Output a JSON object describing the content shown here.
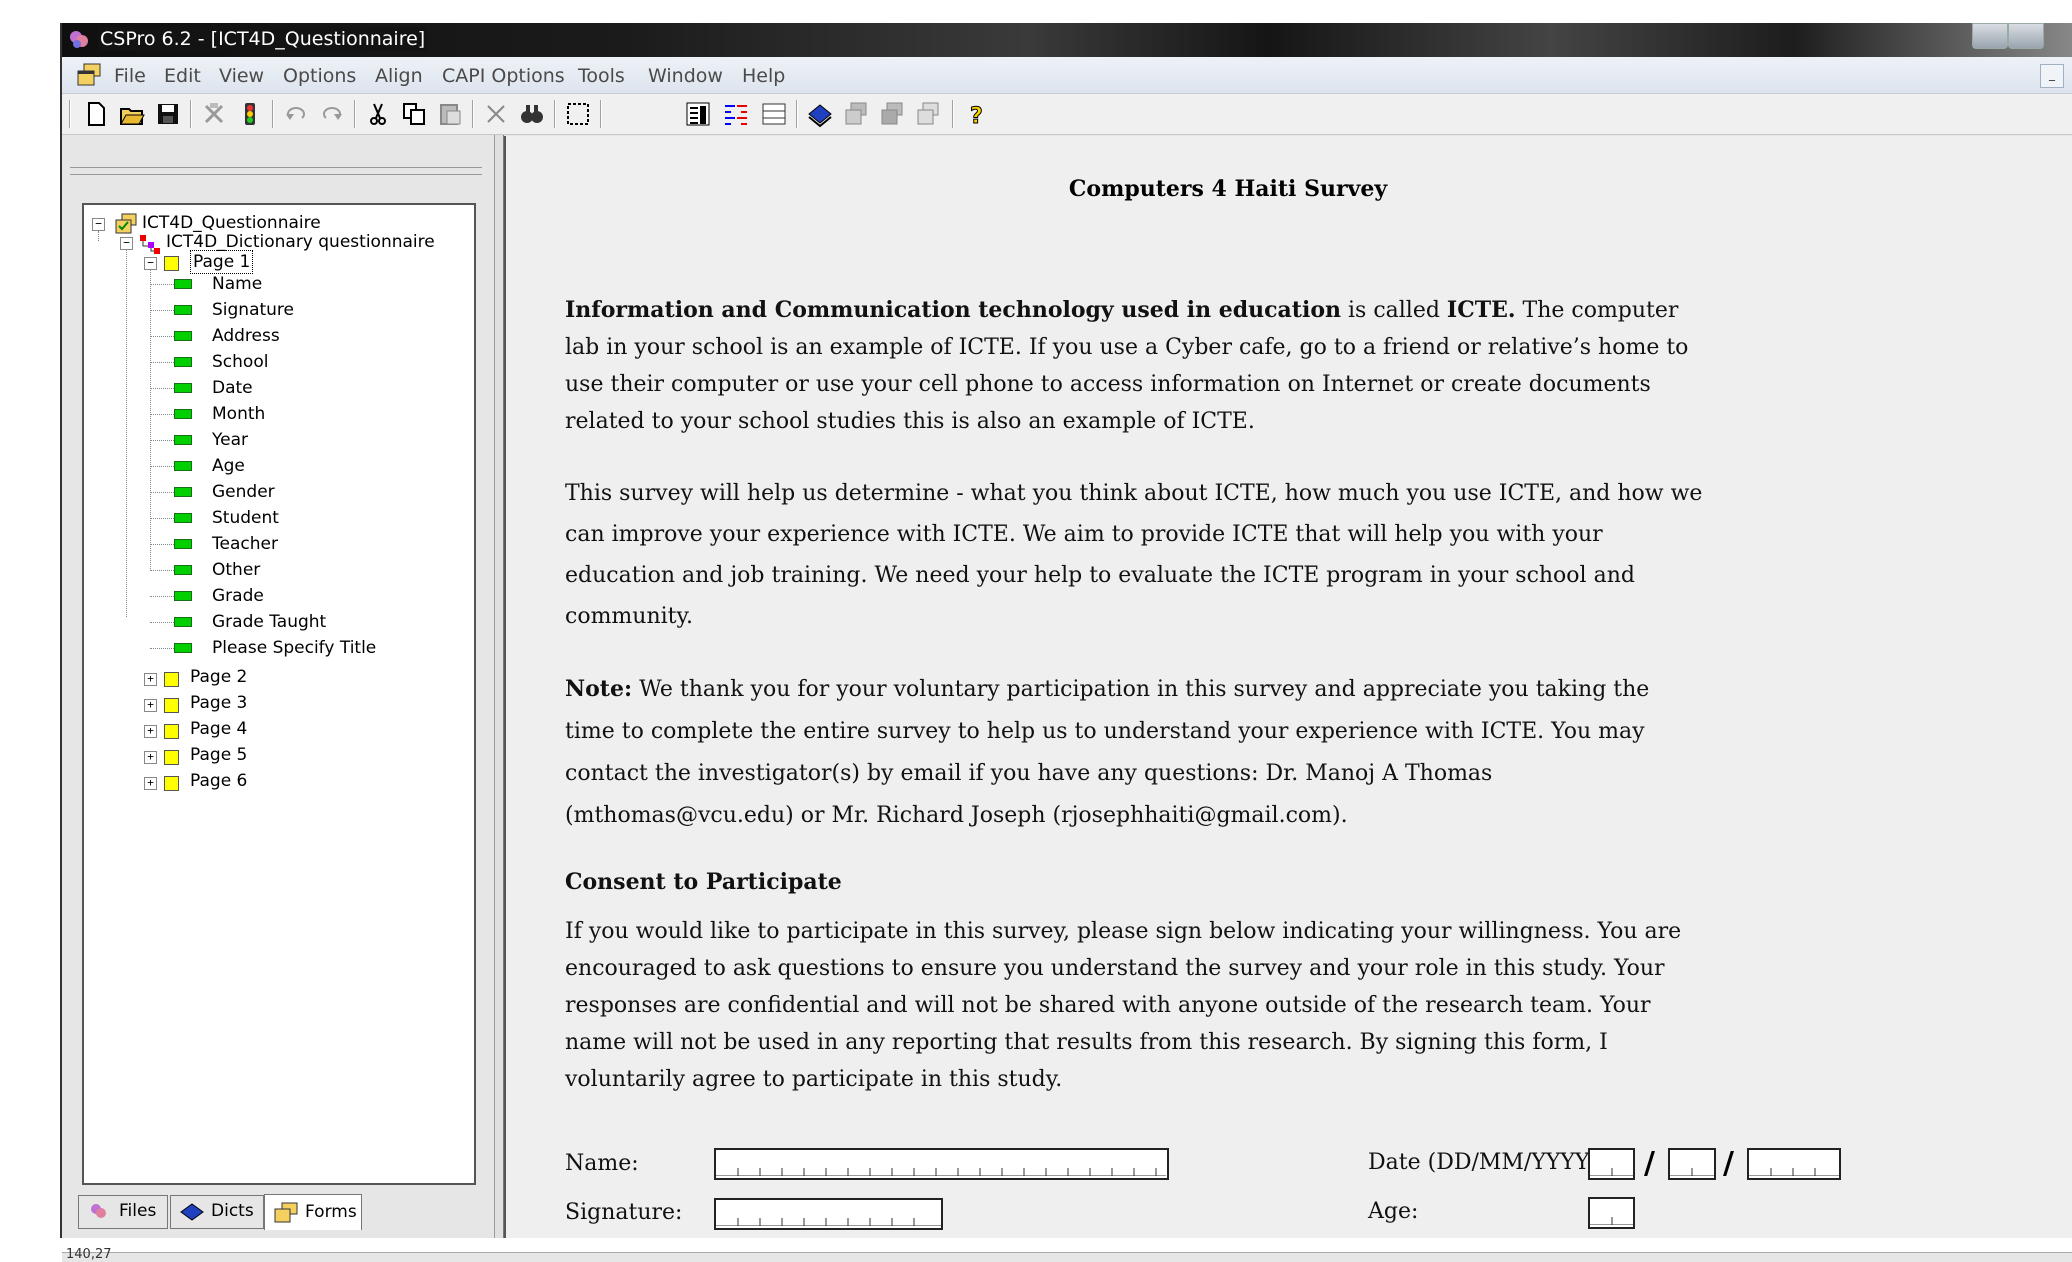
{
  "window": {
    "title": "CSPro 6.2 - [ICT4D_Questionnaire]"
  },
  "menu": [
    "File",
    "Edit",
    "View",
    "Options",
    "Align",
    "CAPI Options",
    "Tools",
    "Window",
    "Help"
  ],
  "toolbar": {
    "buttons": [
      "new-icon",
      "open-icon",
      "save-icon",
      "generate-icon",
      "run-icon",
      "undo-icon",
      "redo-icon",
      "cut-icon",
      "copy-icon",
      "paste-icon",
      "delete-icon",
      "find-icon",
      "select-all-icon",
      "layout-icon",
      "tab-order-icon",
      "grid-icon",
      "dictionary-icon",
      "form-icon",
      "form2-icon",
      "form3-icon",
      "help-icon"
    ]
  },
  "tree": {
    "root": "ICT4D_Questionnaire",
    "dictionary": "ICT4D_Dictionary questionnaire",
    "pages": [
      {
        "label": "Page 1",
        "expanded": true,
        "items": [
          "Name",
          "Signature",
          "Address",
          "School",
          "Date",
          "Month",
          "Year",
          "Age",
          "Gender",
          "Student",
          "Teacher",
          "Other",
          "Grade",
          "Grade Taught",
          "Please Specify Title"
        ]
      },
      {
        "label": "Page 2",
        "expanded": false
      },
      {
        "label": "Page 3",
        "expanded": false
      },
      {
        "label": "Page 4",
        "expanded": false
      },
      {
        "label": "Page 5",
        "expanded": false
      },
      {
        "label": "Page 6",
        "expanded": false
      }
    ]
  },
  "tabs": [
    "Files",
    "Dicts",
    "Forms"
  ],
  "form": {
    "title": "Computers 4 Haiti Survey",
    "intro": {
      "b1": "Information and Communication technology used in education",
      "t1": " is called ",
      "b2": "ICTE.",
      "t2": "  The computer lab in your school is an example of ICTE. If you use a Cyber cafe, go to a friend or relative’s home to use their computer or use your cell phone to access information on Internet or create documents related to your school studies this is also an example of ICTE."
    },
    "para2": "This survey will help us determine - what you think about ICTE, how much you use ICTE, and how we can improve your experience with ICTE. We aim to provide ICTE that will help you with your education and job training. We need your help to evaluate the ICTE program in your school and community.",
    "note": {
      "label": "Note:",
      "text": " We thank you for your voluntary participation in this survey and appreciate you taking the time to complete the entire survey to help us to understand your experience with ICTE. You may contact the investigator(s) by email if you have any questions: Dr. Manoj A Thomas (mthomas@vcu.edu) or Mr. Richard Joseph (rjosephhaiti@gmail.com)."
    },
    "consent_heading": "Consent to Participate",
    "consent_text": "If you would like to participate in this survey, please sign below indicating your willingness. You are encouraged to ask questions to ensure you understand the survey and your role in this study. Your responses are confidential and will not be shared with anyone outside of the research team. Your name will not be used in any reporting that results from this research. By signing this form, I voluntarily agree to participate in this study.",
    "name_label": "Name:",
    "signature_label": "Signature:",
    "date_label": "Date (DD/MM/YYYY):",
    "age_label": "Age:",
    "date_sep": "/"
  },
  "status": {
    "text": "140,27"
  }
}
